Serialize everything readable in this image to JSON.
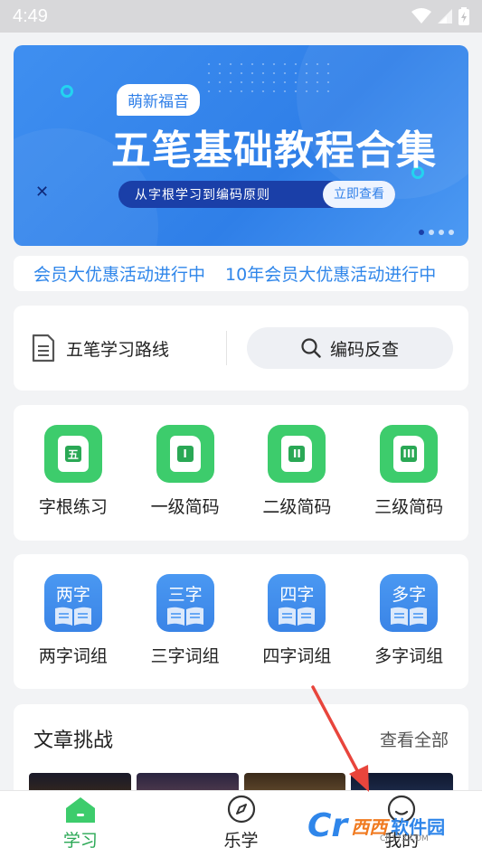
{
  "status_bar": {
    "time": "4:49",
    "icons": [
      "wifi-icon",
      "signal-icon",
      "battery-icon"
    ]
  },
  "banner": {
    "brand": "萌新福音",
    "title": "五笔基础教程合集",
    "subtitle": "从字根学习到编码原则",
    "cta": "立即查看",
    "page_count": 4,
    "active_page": 1
  },
  "marquee": {
    "items": [
      "会员大优惠活动进行中",
      "10年会员大优惠活动进行中"
    ]
  },
  "route": {
    "label": "五笔学习路线",
    "icon": "document-icon"
  },
  "lookup": {
    "label": "编码反查",
    "icon": "search-icon"
  },
  "practice": {
    "items": [
      {
        "glyph": "五",
        "label": "字根练习"
      },
      {
        "glyph": "I",
        "label": "一级简码"
      },
      {
        "glyph": "II",
        "label": "二级简码"
      },
      {
        "glyph": "III",
        "label": "三级简码"
      }
    ]
  },
  "phrases": {
    "items": [
      {
        "chars": "两字",
        "label": "两字词组"
      },
      {
        "chars": "三字",
        "label": "三字词组"
      },
      {
        "chars": "四字",
        "label": "四字词组"
      },
      {
        "chars": "多字",
        "label": "多字词组"
      }
    ]
  },
  "articles": {
    "title": "文章挑战",
    "more": "查看全部"
  },
  "tabbar": {
    "tabs": [
      {
        "label": "学习",
        "icon": "home-icon",
        "active": true
      },
      {
        "label": "乐学",
        "icon": "compass-icon",
        "active": false
      },
      {
        "label": "我的",
        "icon": "profile-icon",
        "active": false
      }
    ]
  },
  "watermark": {
    "logo": "Cr",
    "brand_a": "西西",
    "brand_b": "软件园",
    "url": "CR173.COM"
  },
  "colors": {
    "accent_green": "#3dcc6c",
    "accent_blue": "#2f86ea",
    "banner_blue": "#2f7fe8",
    "annotation_red": "#e8453c"
  }
}
